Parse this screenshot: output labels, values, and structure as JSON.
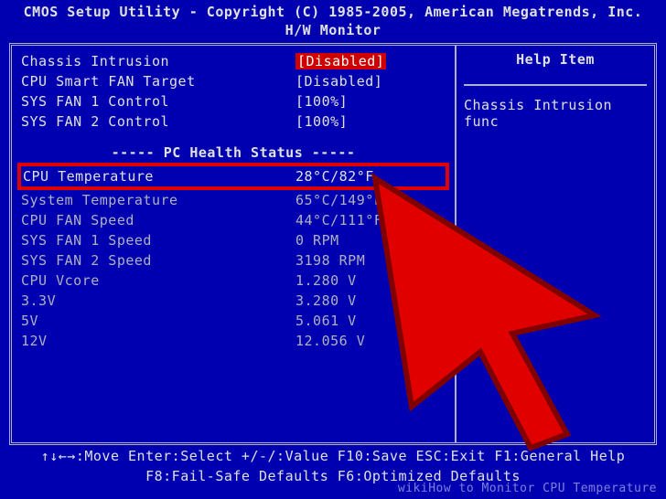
{
  "header": {
    "title": "CMOS Setup Utility - Copyright (C) 1985-2005, American Megatrends, Inc.",
    "subtitle": "H/W Monitor"
  },
  "settings": [
    {
      "label": "Chassis Intrusion",
      "value": "[Disabled]",
      "highlighted": true
    },
    {
      "label": "CPU Smart FAN Target",
      "value": "[Disabled]"
    },
    {
      "label": "SYS FAN 1 Control",
      "value": "[100%]"
    },
    {
      "label": "SYS FAN 2 Control",
      "value": "[100%]"
    }
  ],
  "section_title": "----- PC Health Status -----",
  "health": [
    {
      "label": "CPU Temperature",
      "value": "28°C/82°F",
      "boxed": true
    },
    {
      "label": "System Temperature",
      "value": "65°C/149°F"
    },
    {
      "label": "CPU FAN Speed",
      "value": "44°C/111°F"
    },
    {
      "label": "SYS FAN 1 Speed",
      "value": "0 RPM"
    },
    {
      "label": "SYS FAN 2 Speed",
      "value": "3198 RPM"
    },
    {
      "label": "CPU Vcore",
      "value": "1.280 V"
    },
    {
      "label": "3.3V",
      "value": "3.280 V"
    },
    {
      "label": "5V",
      "value": "5.061 V"
    },
    {
      "label": "12V",
      "value": "12.056 V"
    }
  ],
  "help": {
    "title": "Help Item",
    "text": "Chassis Intrusion func"
  },
  "footer": {
    "line1": "↑↓←→:Move  Enter:Select  +/-/:Value  F10:Save  ESC:Exit  F1:General Help",
    "line2": "F8:Fail-Safe Defaults  F6:Optimized Defaults"
  },
  "watermark": "wikiHow to Monitor CPU Temperature"
}
